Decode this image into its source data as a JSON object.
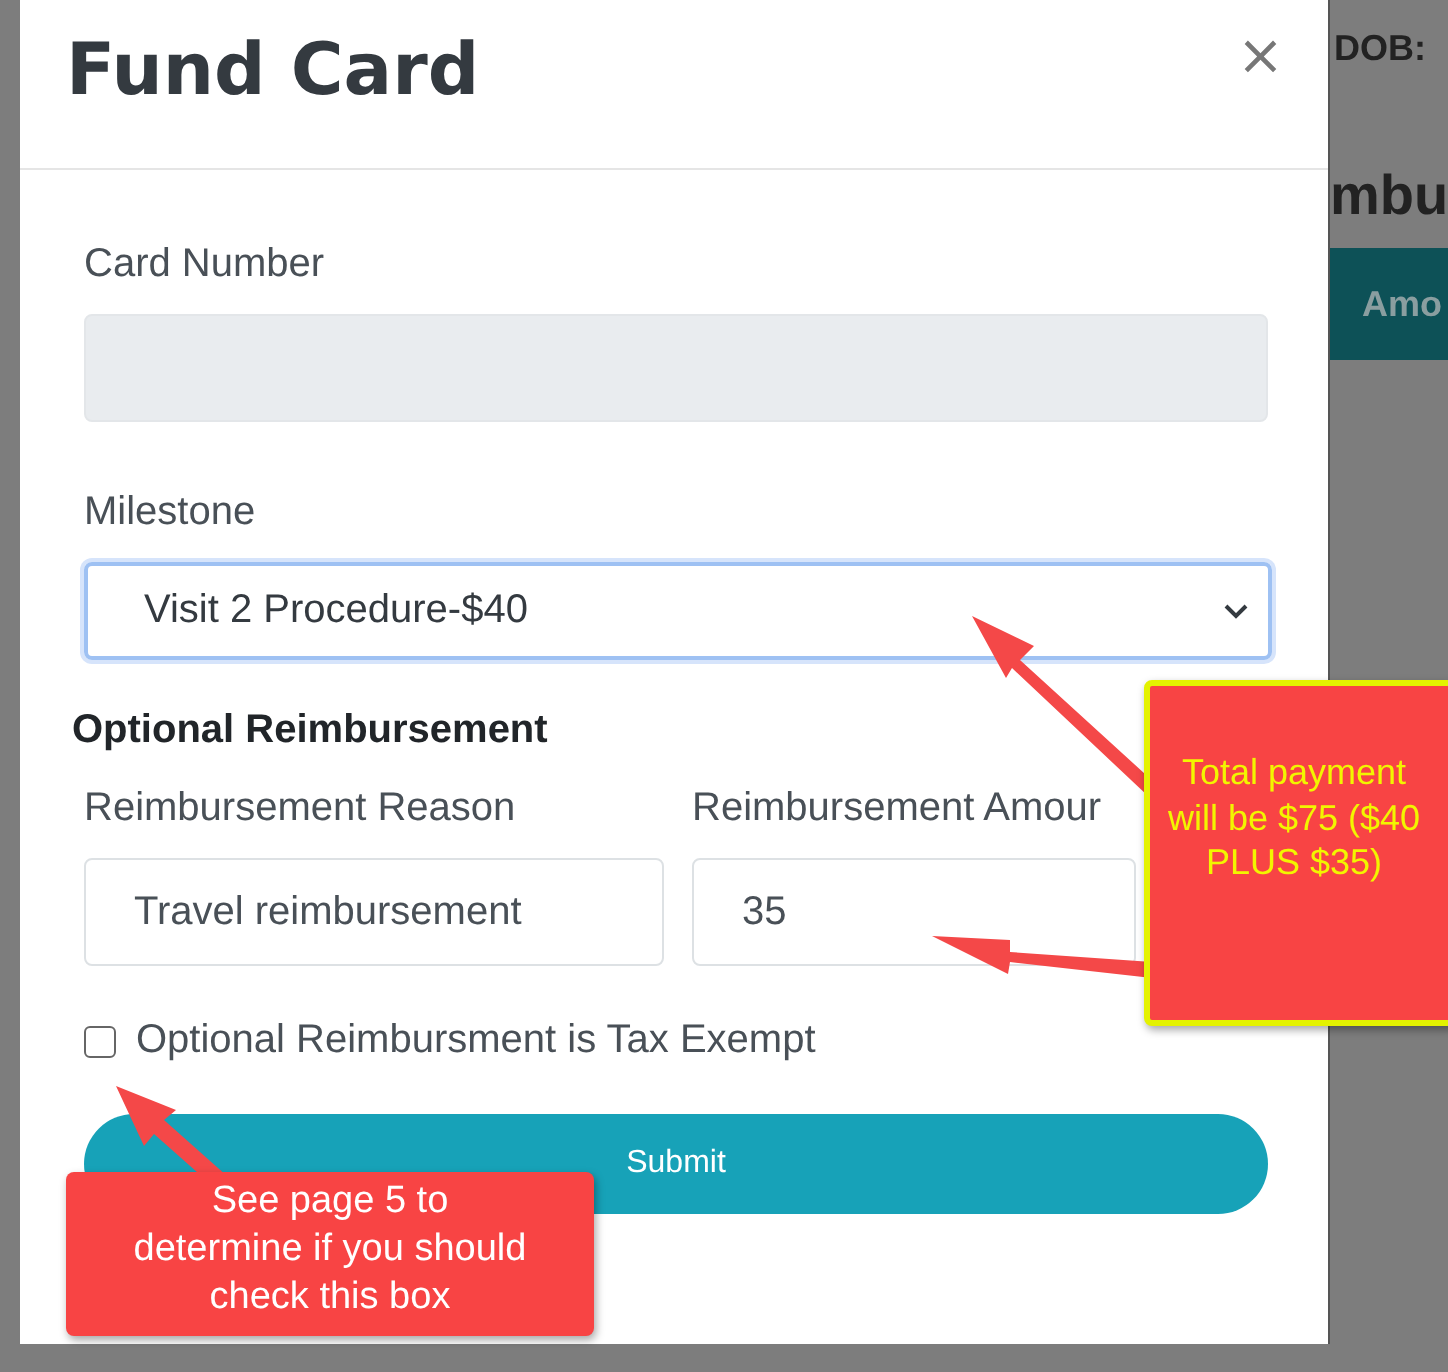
{
  "backdrop": {
    "dob_label": "DOB:",
    "heading": "mbu",
    "table_header": "Amo"
  },
  "modal": {
    "title": "Fund Card",
    "close": "×",
    "card_number": {
      "label": "Card Number",
      "disabled": true
    },
    "milestone": {
      "label": "Milestone",
      "value": "Visit 2 Procedure-$40",
      "focused": true
    },
    "section_heading": "Optional Reimbursement",
    "reason": {
      "label": "Reimbursement Reason",
      "value": "Travel reimbursement"
    },
    "amount": {
      "label": "Reimbursement Amour",
      "value": "35"
    },
    "tax_exempt": {
      "label": "Optional Reimbursment is Tax Exempt",
      "checked": false
    },
    "submit": "Submit"
  },
  "callouts": [
    {
      "kind": "yellow",
      "text": "Total payment will be $75 ($40 PLUS $35)"
    },
    {
      "kind": "white",
      "text": "See page 5 to determine if you should check this box"
    }
  ]
}
